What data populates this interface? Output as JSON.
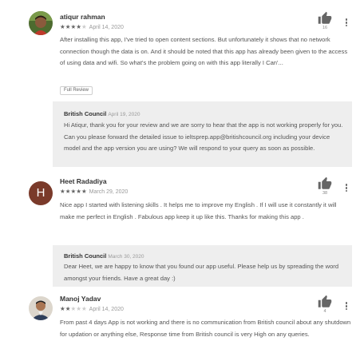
{
  "reviews": [
    {
      "author": "atiqur rahman",
      "stars": 4,
      "stars_total": 5,
      "date": "April 14, 2020",
      "thumbs_count": "16",
      "text": "After installing this app, I've tried to open content sections. But unfortunately it shows that no network connection though the data is on. And it should be noted that this app has already been given to the access of using data and wifi. So what's the problem going on with this app literally I Can'...",
      "full_review_label": "Full Review",
      "reply": {
        "author": "British Council",
        "date": "April 19, 2020",
        "text": "Hi Atiqur, thank you for your review and we are sorry to hear that the app is not working properly for you. Can you please forward the detailed issue to ieltsprep.app@britishcouncil.org including your device model and the app version you are using? We will respond to your query as soon as possible."
      }
    },
    {
      "author": "Heet Radadiya",
      "avatar_letter": "H",
      "stars": 5,
      "stars_total": 5,
      "date": "March 29, 2020",
      "thumbs_count": "38",
      "text": "Nice app I started with listening skills . It helps me to improve my English . If I will use it constantly it will make me perfect in English . Fabulous app keep it up like this. Thanks for making this app .",
      "reply": {
        "author": "British Council",
        "date": "March 30, 2020",
        "text": "Dear Heet, we are happy to know that you found our app useful. Please help us by spreading the word amongst your friends. Have a great day :)"
      }
    },
    {
      "author": "Manoj Yadav",
      "stars": 2,
      "stars_total": 5,
      "date": "April 14, 2020",
      "thumbs_count": "4",
      "text": "From past 4 days App is not working and there is no communication from British council about any shutdown for updation or anything else, Response time from British council is very High on any queries."
    }
  ],
  "colors": {
    "reply_background": "#eeeeee",
    "avatar_h": "#7a3a2a",
    "icon_gray": "#666666"
  },
  "icons": [
    "thumbs-up-icon",
    "more-vert-icon",
    "star-icon"
  ]
}
